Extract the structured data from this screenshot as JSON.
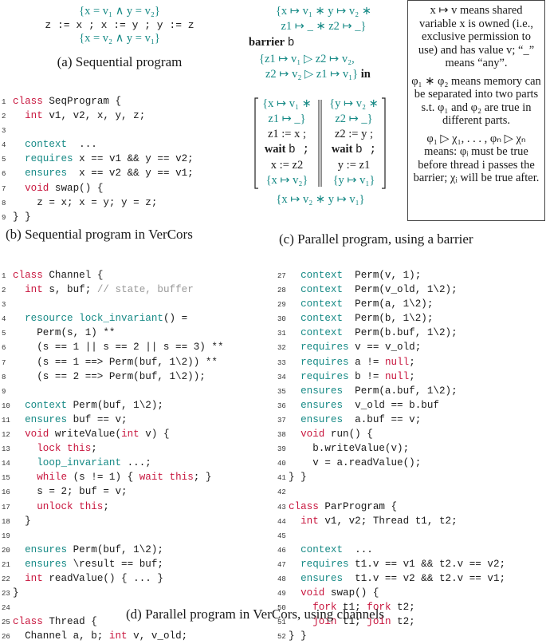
{
  "figure_a": {
    "pre": "{x = v₁ ∧ y = v₂}",
    "stmt": "z := x ; x := y ; y := z",
    "post": "{x = v₂ ∧ y = v₁}",
    "caption": "(a) Sequential program"
  },
  "figure_b": {
    "caption": "(b) Sequential program in VerCors",
    "lines": [
      {
        "n": "1",
        "tokens": [
          {
            "t": "class",
            "c": "red"
          },
          {
            "t": " SeqProgram {"
          }
        ]
      },
      {
        "n": "2",
        "tokens": [
          {
            "t": "  "
          },
          {
            "t": "int",
            "c": "red"
          },
          {
            "t": " v1, v2, x, y, z;"
          }
        ]
      },
      {
        "n": "3",
        "tokens": []
      },
      {
        "n": "4",
        "tokens": [
          {
            "t": "  "
          },
          {
            "t": "context",
            "c": "teal"
          },
          {
            "t": "  ..."
          }
        ]
      },
      {
        "n": "5",
        "tokens": [
          {
            "t": "  "
          },
          {
            "t": "requires",
            "c": "teal"
          },
          {
            "t": " x == v1 && y == v2;"
          }
        ]
      },
      {
        "n": "6",
        "tokens": [
          {
            "t": "  "
          },
          {
            "t": "ensures",
            "c": "teal"
          },
          {
            "t": "  x == v2 && y == v1;"
          }
        ]
      },
      {
        "n": "7",
        "tokens": [
          {
            "t": "  "
          },
          {
            "t": "void",
            "c": "red"
          },
          {
            "t": " swap() {"
          }
        ]
      },
      {
        "n": "8",
        "tokens": [
          {
            "t": "    z = x; x = y; y = z;"
          }
        ]
      },
      {
        "n": "9",
        "tokens": [
          {
            "t": "} }"
          }
        ]
      }
    ]
  },
  "figure_c": {
    "caption": "(c) Parallel program, using a barrier",
    "pre_line1": "{x ↦ v₁ ∗ y ↦ v₂ ∗",
    "pre_line2": "z1 ↦ _ ∗ z2 ↦ _}",
    "barrier_kw": "barrier",
    "barrier_name": "b",
    "spec_line1": "{z1 ↦ v₁ ▷ z2 ↦ v₂,",
    "spec_line2": "z2 ↦ v₂ ▷ z1 ↦ v₁}",
    "in_kw": "in",
    "thread1": {
      "pre1": "{x ↦ v₁ ∗",
      "pre2": "z1 ↦ _}",
      "s1": "z1 := x ;",
      "wait_kw": "wait",
      "wait_arg": "b ;",
      "s3": "x := z2",
      "post": "{x ↦ v₂}"
    },
    "thread2": {
      "pre1": "{y ↦ v₂ ∗",
      "pre2": "z2 ↦ _}",
      "s1": "z2 := y ;",
      "wait_kw": "wait",
      "wait_arg": "b ;",
      "s3": "y := z1",
      "post": "{y ↦ v₁}"
    },
    "post": "{x ↦ v₂ ∗ y ↦ v₁}"
  },
  "legend": {
    "p1": "x ↦ v means shared variable x is owned (i.e., exclusive permission to use) and has value v; “_” means “any”.",
    "p2": "φ₁ ∗ φ₂ means memory can be separated into two parts s.t. φ₁ and φ₂ are true in different parts.",
    "p3": "φ₁ ▷ χ₁, . . . , φₙ ▷ χₙ means: φᵢ must be true before thread i passes the barrier; χᵢ will be true after."
  },
  "figure_d": {
    "caption": "(d) Parallel program in VerCors, using channels",
    "left": [
      {
        "n": "1",
        "tokens": [
          {
            "t": "class",
            "c": "red"
          },
          {
            "t": " Channel {"
          }
        ]
      },
      {
        "n": "2",
        "tokens": [
          {
            "t": "  "
          },
          {
            "t": "int",
            "c": "red"
          },
          {
            "t": " s, buf; "
          },
          {
            "t": "// state, buffer",
            "c": "gray"
          }
        ]
      },
      {
        "n": "3",
        "tokens": []
      },
      {
        "n": "4",
        "tokens": [
          {
            "t": "  "
          },
          {
            "t": "resource lock_invariant",
            "c": "teal"
          },
          {
            "t": "() ="
          }
        ]
      },
      {
        "n": "5",
        "tokens": [
          {
            "t": "    Perm(s, 1) **"
          }
        ]
      },
      {
        "n": "6",
        "tokens": [
          {
            "t": "    (s == 1 || s == 2 || s == 3) **"
          }
        ]
      },
      {
        "n": "7",
        "tokens": [
          {
            "t": "    (s == 1 ==> Perm(buf, 1\\2)) **"
          }
        ]
      },
      {
        "n": "8",
        "tokens": [
          {
            "t": "    (s == 2 ==> Perm(buf, 1\\2));"
          }
        ]
      },
      {
        "n": "9",
        "tokens": []
      },
      {
        "n": "10",
        "tokens": [
          {
            "t": "  "
          },
          {
            "t": "context",
            "c": "teal"
          },
          {
            "t": " Perm(buf, 1\\2);"
          }
        ]
      },
      {
        "n": "11",
        "tokens": [
          {
            "t": "  "
          },
          {
            "t": "ensures",
            "c": "teal"
          },
          {
            "t": " buf == v;"
          }
        ]
      },
      {
        "n": "12",
        "tokens": [
          {
            "t": "  "
          },
          {
            "t": "void",
            "c": "red"
          },
          {
            "t": " writeValue("
          },
          {
            "t": "int",
            "c": "red"
          },
          {
            "t": " v) {"
          }
        ]
      },
      {
        "n": "13",
        "tokens": [
          {
            "t": "    "
          },
          {
            "t": "lock this",
            "c": "red"
          },
          {
            "t": ";"
          }
        ]
      },
      {
        "n": "14",
        "tokens": [
          {
            "t": "    "
          },
          {
            "t": "loop_invariant",
            "c": "teal"
          },
          {
            "t": " ...;"
          }
        ]
      },
      {
        "n": "15",
        "tokens": [
          {
            "t": "    "
          },
          {
            "t": "while",
            "c": "red"
          },
          {
            "t": " (s != 1) { "
          },
          {
            "t": "wait this",
            "c": "red"
          },
          {
            "t": "; }"
          }
        ]
      },
      {
        "n": "16",
        "tokens": [
          {
            "t": "    s = 2; buf = v;"
          }
        ]
      },
      {
        "n": "17",
        "tokens": [
          {
            "t": "    "
          },
          {
            "t": "unlock this",
            "c": "red"
          },
          {
            "t": ";"
          }
        ]
      },
      {
        "n": "18",
        "tokens": [
          {
            "t": "  }"
          }
        ]
      },
      {
        "n": "19",
        "tokens": []
      },
      {
        "n": "20",
        "tokens": [
          {
            "t": "  "
          },
          {
            "t": "ensures",
            "c": "teal"
          },
          {
            "t": " Perm(buf, 1\\2);"
          }
        ]
      },
      {
        "n": "21",
        "tokens": [
          {
            "t": "  "
          },
          {
            "t": "ensures",
            "c": "teal"
          },
          {
            "t": " \\result == buf;"
          }
        ]
      },
      {
        "n": "22",
        "tokens": [
          {
            "t": "  "
          },
          {
            "t": "int",
            "c": "red"
          },
          {
            "t": " readValue() { ... }"
          }
        ]
      },
      {
        "n": "23",
        "tokens": [
          {
            "t": "}"
          }
        ]
      },
      {
        "n": "24",
        "tokens": []
      },
      {
        "n": "25",
        "tokens": [
          {
            "t": "class",
            "c": "red"
          },
          {
            "t": " Thread {"
          }
        ]
      },
      {
        "n": "26",
        "tokens": [
          {
            "t": "  Channel a, b; "
          },
          {
            "t": "int",
            "c": "red"
          },
          {
            "t": " v, v_old;"
          }
        ]
      }
    ],
    "right": [
      {
        "n": "27",
        "tokens": [
          {
            "t": "  "
          },
          {
            "t": "context",
            "c": "teal"
          },
          {
            "t": "  Perm(v, 1);"
          }
        ]
      },
      {
        "n": "28",
        "tokens": [
          {
            "t": "  "
          },
          {
            "t": "context",
            "c": "teal"
          },
          {
            "t": "  Perm(v_old, 1\\2);"
          }
        ]
      },
      {
        "n": "29",
        "tokens": [
          {
            "t": "  "
          },
          {
            "t": "context",
            "c": "teal"
          },
          {
            "t": "  Perm(a, 1\\2);"
          }
        ]
      },
      {
        "n": "30",
        "tokens": [
          {
            "t": "  "
          },
          {
            "t": "context",
            "c": "teal"
          },
          {
            "t": "  Perm(b, 1\\2);"
          }
        ]
      },
      {
        "n": "31",
        "tokens": [
          {
            "t": "  "
          },
          {
            "t": "context",
            "c": "teal"
          },
          {
            "t": "  Perm(b.buf, 1\\2);"
          }
        ]
      },
      {
        "n": "32",
        "tokens": [
          {
            "t": "  "
          },
          {
            "t": "requires",
            "c": "teal"
          },
          {
            "t": " v == v_old;"
          }
        ]
      },
      {
        "n": "33",
        "tokens": [
          {
            "t": "  "
          },
          {
            "t": "requires",
            "c": "teal"
          },
          {
            "t": " a != "
          },
          {
            "t": "null",
            "c": "red"
          },
          {
            "t": ";"
          }
        ]
      },
      {
        "n": "34",
        "tokens": [
          {
            "t": "  "
          },
          {
            "t": "requires",
            "c": "teal"
          },
          {
            "t": " b != "
          },
          {
            "t": "null",
            "c": "red"
          },
          {
            "t": ";"
          }
        ]
      },
      {
        "n": "35",
        "tokens": [
          {
            "t": "  "
          },
          {
            "t": "ensures",
            "c": "teal"
          },
          {
            "t": "  Perm(a.buf, 1\\2);"
          }
        ]
      },
      {
        "n": "36",
        "tokens": [
          {
            "t": "  "
          },
          {
            "t": "ensures",
            "c": "teal"
          },
          {
            "t": "  v_old == b.buf"
          }
        ]
      },
      {
        "n": "37",
        "tokens": [
          {
            "t": "  "
          },
          {
            "t": "ensures",
            "c": "teal"
          },
          {
            "t": "  a.buf == v;"
          }
        ]
      },
      {
        "n": "38",
        "tokens": [
          {
            "t": "  "
          },
          {
            "t": "void",
            "c": "red"
          },
          {
            "t": " run() {"
          }
        ]
      },
      {
        "n": "39",
        "tokens": [
          {
            "t": "    b.writeValue(v);"
          }
        ]
      },
      {
        "n": "40",
        "tokens": [
          {
            "t": "    v = a.readValue();"
          }
        ]
      },
      {
        "n": "41",
        "tokens": [
          {
            "t": "} }"
          }
        ]
      },
      {
        "n": "42",
        "tokens": []
      },
      {
        "n": "43",
        "tokens": [
          {
            "t": "class",
            "c": "red"
          },
          {
            "t": " ParProgram {"
          }
        ]
      },
      {
        "n": "44",
        "tokens": [
          {
            "t": "  "
          },
          {
            "t": "int",
            "c": "red"
          },
          {
            "t": " v1, v2; Thread t1, t2;"
          }
        ]
      },
      {
        "n": "45",
        "tokens": []
      },
      {
        "n": "46",
        "tokens": [
          {
            "t": "  "
          },
          {
            "t": "context",
            "c": "teal"
          },
          {
            "t": "  ..."
          }
        ]
      },
      {
        "n": "47",
        "tokens": [
          {
            "t": "  "
          },
          {
            "t": "requires",
            "c": "teal"
          },
          {
            "t": " t1.v == v1 && t2.v == v2;"
          }
        ]
      },
      {
        "n": "48",
        "tokens": [
          {
            "t": "  "
          },
          {
            "t": "ensures",
            "c": "teal"
          },
          {
            "t": "  t1.v == v2 && t2.v == v1;"
          }
        ]
      },
      {
        "n": "49",
        "tokens": [
          {
            "t": "  "
          },
          {
            "t": "void",
            "c": "red"
          },
          {
            "t": " swap() {"
          }
        ]
      },
      {
        "n": "50",
        "tokens": [
          {
            "t": "    "
          },
          {
            "t": "fork",
            "c": "red"
          },
          {
            "t": " t1; "
          },
          {
            "t": "fork",
            "c": "red"
          },
          {
            "t": " t2;"
          }
        ]
      },
      {
        "n": "51",
        "tokens": [
          {
            "t": "    "
          },
          {
            "t": "join",
            "c": "red"
          },
          {
            "t": " t1; "
          },
          {
            "t": "join",
            "c": "red"
          },
          {
            "t": " t2;"
          }
        ]
      },
      {
        "n": "52",
        "tokens": [
          {
            "t": "} }"
          }
        ]
      }
    ]
  },
  "colors": {
    "keyword_red": "#c8163e",
    "spec_teal": "#178a86",
    "comment_gray": "#999999"
  }
}
